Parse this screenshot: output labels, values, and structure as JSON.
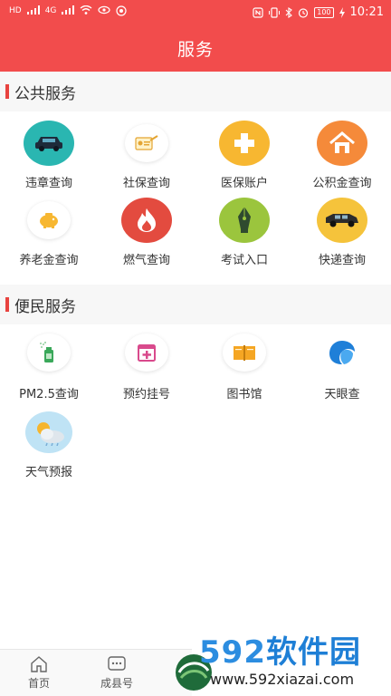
{
  "status_bar": {
    "left_indicators": [
      "HD",
      "4G",
      "4G"
    ],
    "battery": "100",
    "time": "10:21"
  },
  "header": {
    "title": "服务"
  },
  "public_services": {
    "title": "公共服务",
    "items": [
      {
        "label": "违章查询",
        "icon": "car-icon",
        "color": "#2ab6b1"
      },
      {
        "label": "社保查询",
        "icon": "social-security-card-icon",
        "color": "#ffffff"
      },
      {
        "label": "医保账户",
        "icon": "medical-cross-icon",
        "color": "#f7b731"
      },
      {
        "label": "公积金查询",
        "icon": "house-icon",
        "color": "#f58a3a"
      },
      {
        "label": "养老金查询",
        "icon": "piggy-bank-icon",
        "color": "#ffffff"
      },
      {
        "label": "燃气查询",
        "icon": "flame-icon",
        "color": "#e34b3f"
      },
      {
        "label": "考试入口",
        "icon": "pen-icon",
        "color": "#9bc53d"
      },
      {
        "label": "快递查询",
        "icon": "delivery-van-icon",
        "color": "#f5c33b"
      }
    ]
  },
  "convenience_services": {
    "title": "便民服务",
    "items": [
      {
        "label": "PM2.5查询",
        "icon": "air-spray-icon",
        "color": "#ffffff"
      },
      {
        "label": "预约挂号",
        "icon": "hospital-register-icon",
        "color": "#ffffff"
      },
      {
        "label": "图书馆",
        "icon": "book-icon",
        "color": "#ffffff"
      },
      {
        "label": "天眼查",
        "icon": "tianyancha-logo-icon",
        "color": "#ffffff"
      },
      {
        "label": "天气预报",
        "icon": "weather-icon",
        "color": "#ffffff"
      }
    ]
  },
  "bottom_nav": {
    "items": [
      {
        "label": "首页",
        "icon": "home-icon"
      },
      {
        "label": "成县号",
        "icon": "chat-bubble-icon"
      }
    ]
  },
  "watermark": {
    "brand_digits": "592",
    "brand_text": "软件园",
    "url": "www.592xiazai.com"
  }
}
